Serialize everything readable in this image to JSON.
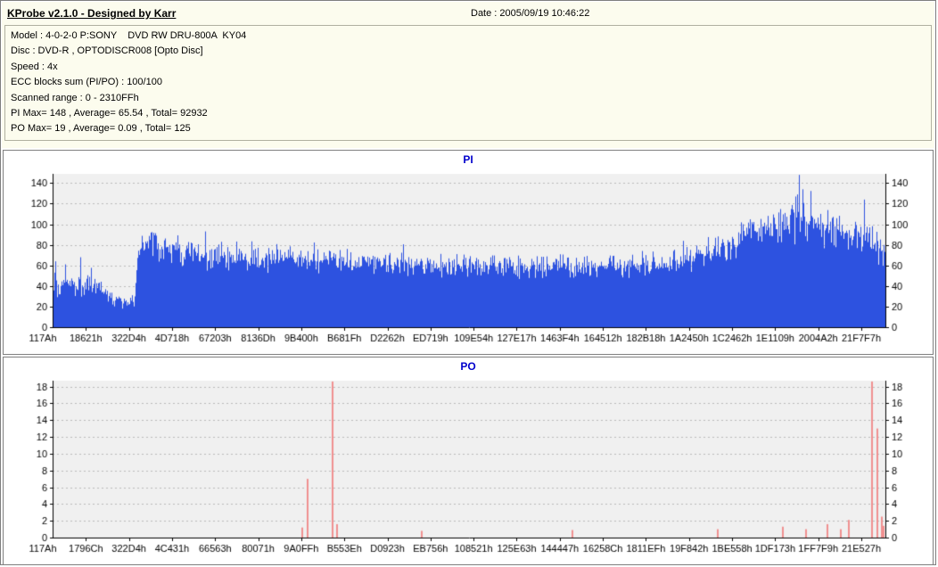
{
  "header": {
    "title": "KProbe v2.1.0 - Designed by Karr",
    "date_label": "Date : 2005/09/19 10:46:22"
  },
  "info": {
    "lines": [
      "Model : 4-0-2-0 P:SONY    DVD RW DRU-800A  KY04",
      "Disc : DVD-R , OPTODISCR008 [Opto Disc]",
      "Speed : 4x",
      "ECC blocks sum (PI/PO) : 100/100",
      "Scanned range : 0 - 2310FFh",
      "PI Max= 148 , Average= 65.54 , Total= 92932",
      "PO Max= 19 , Average= 0.09 , Total= 125"
    ]
  },
  "colors": {
    "pi_bar": "#2d52e0",
    "po_bar": "#f09090",
    "plot_background": "#f0f0f0",
    "grid_line": "#b9b9b9",
    "chart_title": "#0000cc",
    "panel_background": "#fcfcee"
  },
  "chart_data": [
    {
      "type": "bar",
      "title": "PI",
      "color": "#2d52e0",
      "ylim": [
        0,
        149
      ],
      "yticks": [
        0,
        20,
        40,
        60,
        80,
        100,
        120,
        140
      ],
      "grid": true,
      "x_tick_labels": [
        "117Ah",
        "18621h",
        "322D4h",
        "4D718h",
        "67203h",
        "8136Dh",
        "9B400h",
        "B681Fh",
        "D2262h",
        "ED719h",
        "109E54h",
        "127E17h",
        "1463F4h",
        "164512h",
        "182B18h",
        "1A2450h",
        "1C2462h",
        "1E1109h",
        "2004A2h",
        "21F7F7h"
      ],
      "stats": {
        "max": 148,
        "average": 65.54,
        "total": 92932
      },
      "envelope": [
        [
          0.0,
          42,
          16
        ],
        [
          0.03,
          45,
          18
        ],
        [
          0.06,
          36,
          12
        ],
        [
          0.075,
          27,
          9
        ],
        [
          0.098,
          23,
          8
        ],
        [
          0.103,
          80,
          18
        ],
        [
          0.125,
          79,
          17
        ],
        [
          0.16,
          73,
          16
        ],
        [
          0.21,
          68,
          16
        ],
        [
          0.27,
          67,
          17
        ],
        [
          0.33,
          64,
          15
        ],
        [
          0.39,
          62,
          14
        ],
        [
          0.45,
          61,
          14
        ],
        [
          0.51,
          59,
          13
        ],
        [
          0.57,
          58,
          13
        ],
        [
          0.63,
          59,
          14
        ],
        [
          0.69,
          60,
          14
        ],
        [
          0.74,
          63,
          15
        ],
        [
          0.78,
          68,
          16
        ],
        [
          0.81,
          78,
          19
        ],
        [
          0.84,
          93,
          22
        ],
        [
          0.87,
          101,
          24
        ],
        [
          0.895,
          108,
          28
        ],
        [
          0.915,
          103,
          26
        ],
        [
          0.935,
          94,
          24
        ],
        [
          0.96,
          89,
          23
        ],
        [
          0.98,
          84,
          24
        ],
        [
          1.0,
          70,
          16
        ]
      ],
      "peaks": [
        [
          0.003,
          64
        ],
        [
          0.893,
          127
        ],
        [
          0.897,
          148
        ],
        [
          0.901,
          134
        ],
        [
          0.975,
          124
        ]
      ]
    },
    {
      "type": "bar",
      "title": "PO",
      "color": "#f09090",
      "ylim": [
        0,
        18.7
      ],
      "yticks": [
        0,
        2,
        4,
        6,
        8,
        10,
        12,
        14,
        16,
        18
      ],
      "grid": true,
      "x_tick_labels": [
        "117Ah",
        "1796Ch",
        "322D4h",
        "4C431h",
        "66563h",
        "80071h",
        "9A0FFh",
        "B553Eh",
        "D0923h",
        "EB756h",
        "108521h",
        "125E63h",
        "144447h",
        "16258Ch",
        "1811EFh",
        "19F842h",
        "1BE558h",
        "1DF173h",
        "1FF7F9h",
        "21E527h"
      ],
      "stats": {
        "max": 19,
        "average": 0.09,
        "total": 125
      },
      "spikes": [
        [
          0.3,
          1.2
        ],
        [
          0.307,
          7
        ],
        [
          0.3365,
          18.6
        ],
        [
          0.342,
          1.6
        ],
        [
          0.444,
          0.8
        ],
        [
          0.625,
          0.9
        ],
        [
          0.8,
          1.0
        ],
        [
          0.878,
          1.3
        ],
        [
          0.906,
          1.0
        ],
        [
          0.931,
          1.6
        ],
        [
          0.947,
          1.0
        ],
        [
          0.957,
          2.1
        ],
        [
          0.985,
          18.6
        ],
        [
          0.991,
          13
        ],
        [
          0.9965,
          2.5
        ],
        [
          0.999,
          1.4
        ]
      ]
    }
  ]
}
